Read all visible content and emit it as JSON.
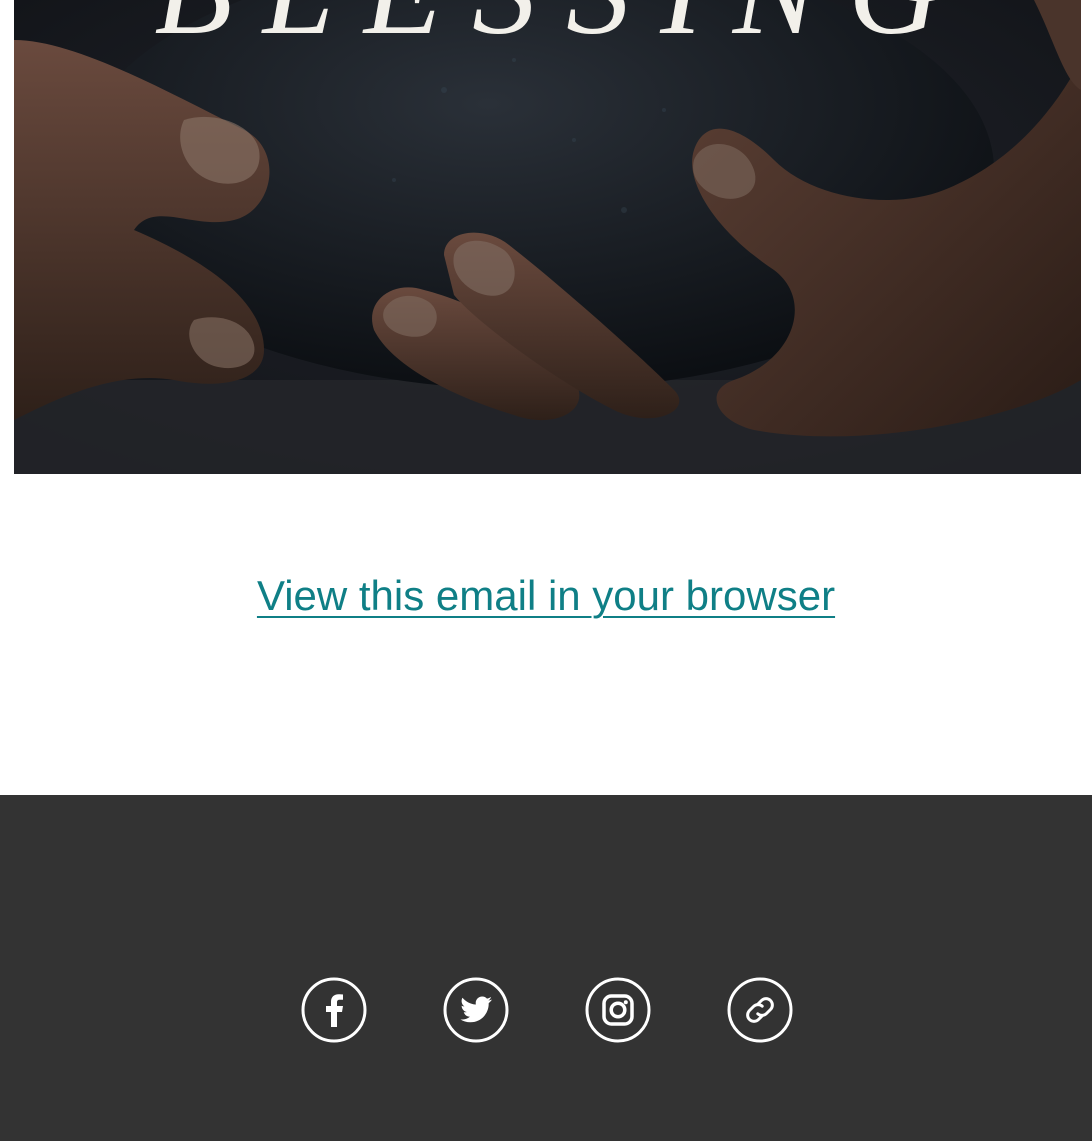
{
  "hero": {
    "title": "BLESSING"
  },
  "browser_link": {
    "label": "View this email in your browser"
  },
  "footer": {
    "background": "#333333",
    "social": [
      {
        "icon": "facebook-icon"
      },
      {
        "icon": "twitter-icon"
      },
      {
        "icon": "instagram-icon"
      },
      {
        "icon": "link-icon"
      }
    ]
  },
  "colors": {
    "link": "#0f7f86",
    "icon": "#ffffff"
  }
}
